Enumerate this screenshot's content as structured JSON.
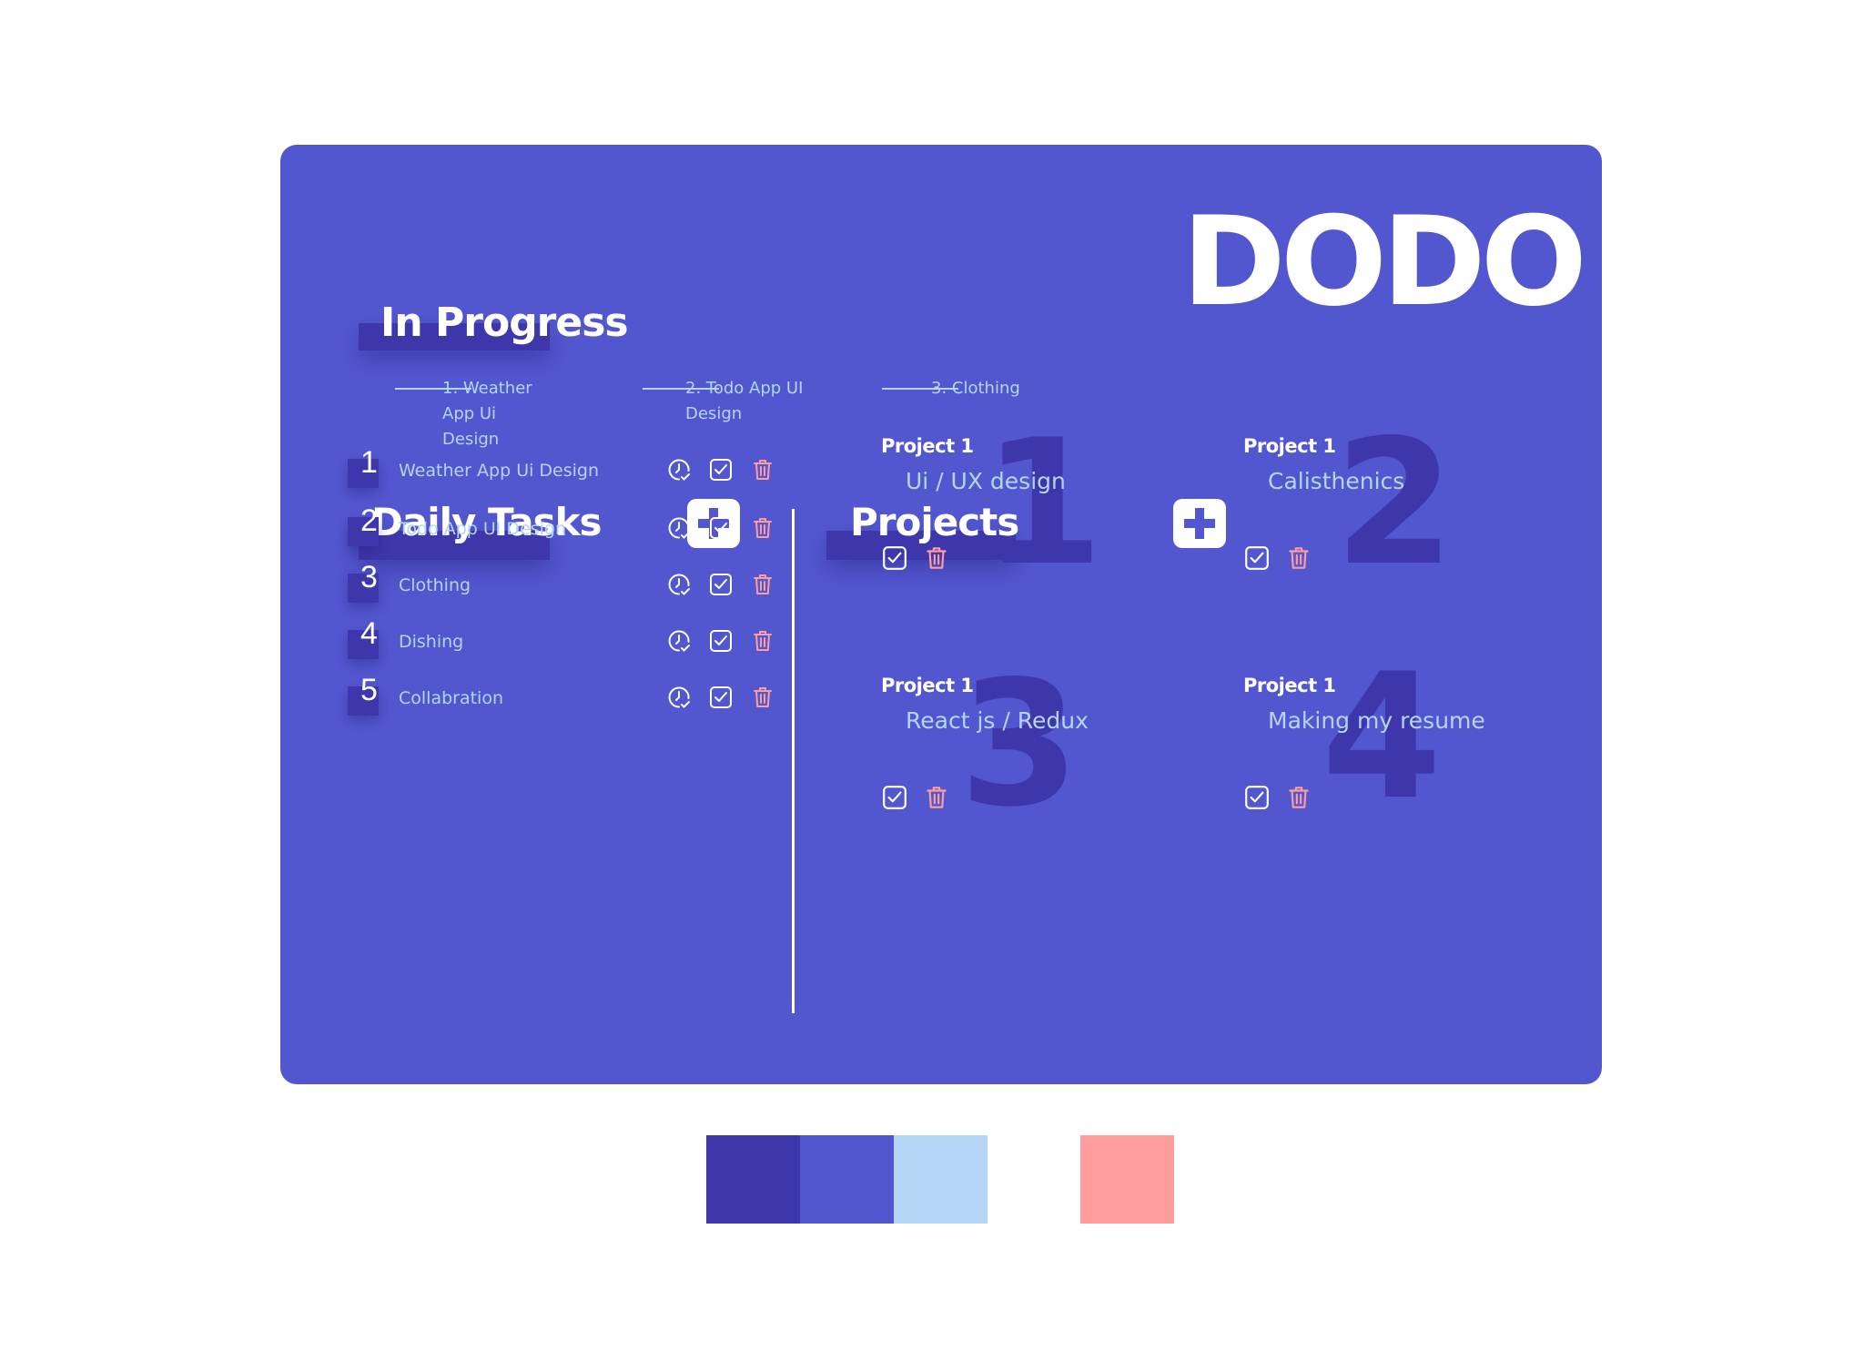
{
  "app": {
    "brand": "DODO"
  },
  "in_progress": {
    "heading": "In Progress",
    "items": [
      "1. Weather App Ui Design",
      "2. Todo App UI Design",
      "3. Clothing"
    ]
  },
  "daily_tasks": {
    "heading": "Daily Tasks",
    "add_icon": "plus-icon",
    "tasks": [
      {
        "number": "1",
        "label": "Weather App Ui Design"
      },
      {
        "number": "2",
        "label": "Todo App UI Design"
      },
      {
        "number": "3",
        "label": "Clothing"
      },
      {
        "number": "4",
        "label": "Dishing"
      },
      {
        "number": "5",
        "label": "Collabration"
      }
    ],
    "row_icons": [
      "clock-check-icon",
      "checkbox-icon",
      "trash-icon"
    ]
  },
  "projects": {
    "heading": "Projects",
    "add_icon": "plus-icon",
    "items": [
      {
        "number": "1",
        "title": "Project 1",
        "name": "Ui / UX design"
      },
      {
        "number": "2",
        "title": "Project 1",
        "name": "Calisthenics"
      },
      {
        "number": "3",
        "title": "Project 1",
        "name": "React js / Redux"
      },
      {
        "number": "4",
        "title": "Project 1",
        "name": "Making my resume"
      }
    ]
  },
  "palette": [
    "#3e37ab",
    "#5357cf",
    "#b4d5f6",
    "#ff9d9d"
  ],
  "colors": {
    "card": "#5357cf",
    "accent_dark": "#3e37ab",
    "text_light": "#b4d5f6",
    "danger": "#ff9d9d",
    "white": "#ffffff"
  }
}
